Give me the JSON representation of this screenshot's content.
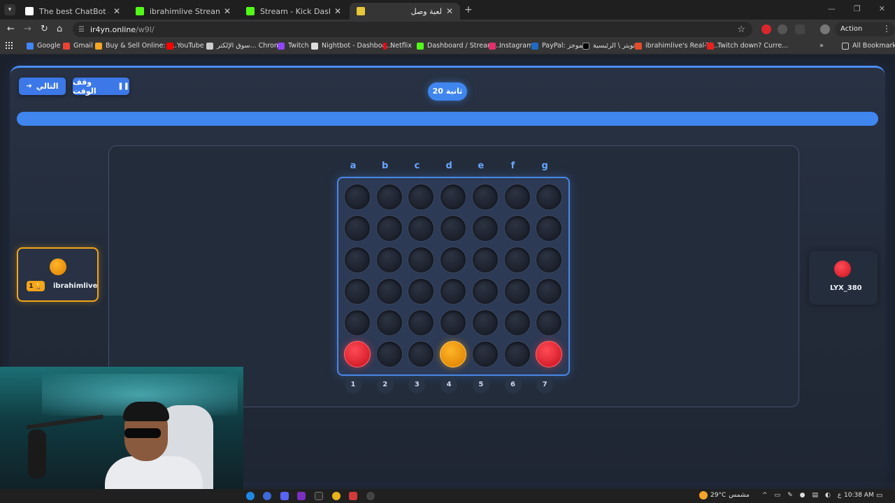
{
  "browser": {
    "tabs": [
      {
        "title": "The best ChatBot and Widgets",
        "active": false,
        "favicon_color": "#ffffff"
      },
      {
        "title": "ibrahimlive Stream - Watch Live",
        "active": false,
        "favicon_color": "#53fc18"
      },
      {
        "title": "Stream - Kick Dashboard",
        "active": false,
        "favicon_color": "#53fc18"
      },
      {
        "title": "لعبة وصل",
        "active": true,
        "favicon_color": "#e8c63a"
      }
    ],
    "url_host": "ir4yn.online",
    "url_path": "/w9l/",
    "action_required": "Action required",
    "bookmarks": [
      {
        "label": "Google",
        "color": "#4285f4"
      },
      {
        "label": "Gmail",
        "color": "#ea4335"
      },
      {
        "label": "Buy & Sell Online: P...",
        "color": "#f5a623"
      },
      {
        "label": "YouTube",
        "color": "#ff0000"
      },
      {
        "label": "سوق الإلكتر... Chrome",
        "color": "#cccccc"
      },
      {
        "label": "Twitch",
        "color": "#9146ff"
      },
      {
        "label": "Nightbot - Dashboa...",
        "color": "#dddddd"
      },
      {
        "label": "Netflix",
        "color": "#e50914"
      },
      {
        "label": "Dashboard / Stream...",
        "color": "#53fc18"
      },
      {
        "label": "Instagram",
        "color": "#e1306c"
      },
      {
        "label": "PayPal: الموجز",
        "color": "#1f6ac4"
      },
      {
        "label": "تويتر \\ الرئيسية",
        "color": "#000000"
      },
      {
        "label": "ibrahimlive's Real-Ti...",
        "color": "#e24c2b"
      },
      {
        "label": "Twitch down? Curre...",
        "color": "#e82020"
      }
    ],
    "all_bookmarks": "All Bookmarks"
  },
  "game": {
    "next_button": "التالي",
    "pause_button": "وقف الوقت",
    "timer": "20 ثانية",
    "progress_fraction": 1.0,
    "column_letters": [
      "a",
      "b",
      "c",
      "d",
      "e",
      "f",
      "g"
    ],
    "column_numbers": [
      "1",
      "2",
      "3",
      "4",
      "5",
      "6",
      "7"
    ],
    "rows": 6,
    "cols": 7,
    "pieces": [
      {
        "row": 6,
        "col": 1,
        "color": "red"
      },
      {
        "row": 6,
        "col": 4,
        "color": "yellow"
      },
      {
        "row": 6,
        "col": 7,
        "color": "red"
      }
    ],
    "player_left": {
      "name": "ibrahimlive",
      "disc_color": "yellow",
      "score": "1"
    },
    "player_right": {
      "name": "LYX_380",
      "disc_color": "red"
    }
  },
  "taskbar": {
    "temperature": "29°C",
    "weather_label": "مشمس",
    "lang": "ع",
    "time": "10:38 AM"
  },
  "colors": {
    "accent": "#3f86ef",
    "yellow_player": "#f3a51a",
    "red_player": "#e0242f"
  }
}
